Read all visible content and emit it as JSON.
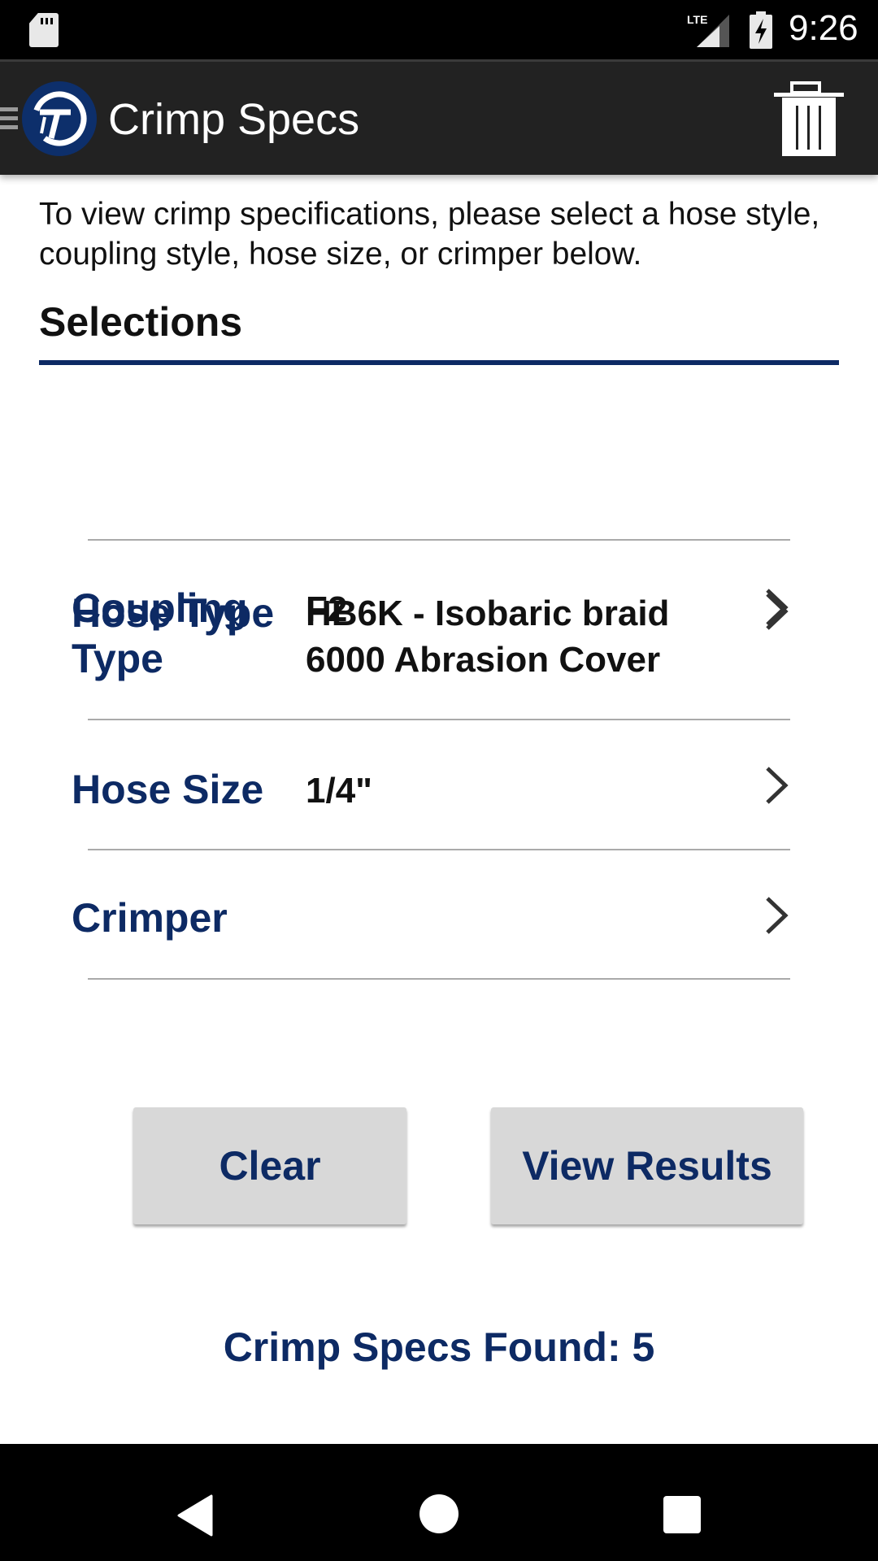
{
  "status_bar": {
    "time": "9:26",
    "network": "LTE",
    "icons": [
      "sd-card-icon",
      "lte-signal-icon",
      "battery-charging-icon"
    ]
  },
  "app_bar": {
    "title": "Crimp Specs",
    "icons": [
      "menu-icon",
      "app-logo",
      "trash-icon"
    ]
  },
  "intro_text": "To view crimp specifications, please select a hose style, coupling style, hose size, or crimper below.",
  "section_title": "Selections",
  "selections": [
    {
      "label": "Hose Type",
      "value": "HB6K - Isobaric braid 6000 Abrasion Cover"
    },
    {
      "label": "Coupling Type",
      "value": "F2"
    },
    {
      "label": "Hose Size",
      "value": "1/4\""
    },
    {
      "label": "Crimper",
      "value": ""
    }
  ],
  "buttons": {
    "clear": "Clear",
    "view_results": "View Results"
  },
  "results": {
    "text": "Crimp Specs Found: 5",
    "count": 5
  },
  "colors": {
    "accent": "#0d2a64",
    "app_bar": "#222222",
    "button_bg": "#d8d8d8"
  },
  "nav_bar": {
    "icons": [
      "back-icon",
      "home-icon",
      "recents-icon"
    ]
  }
}
